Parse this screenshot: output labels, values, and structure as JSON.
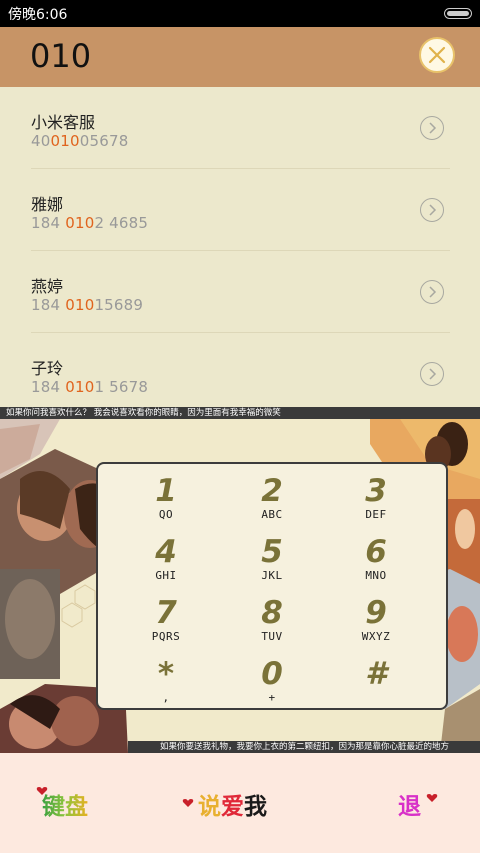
{
  "status_bar": {
    "time": "傍晚6:06"
  },
  "search": {
    "query": "010"
  },
  "results": [
    {
      "name": "小米客服",
      "number_prefix": "40",
      "number_match": "010",
      "number_suffix": "05678"
    },
    {
      "name": "雅娜",
      "number_prefix": "184 ",
      "number_match": "010",
      "number_suffix": "2 4685"
    },
    {
      "name": "燕婷",
      "number_prefix": "184 ",
      "number_match": "010",
      "number_suffix": "15689"
    },
    {
      "name": "子玲",
      "number_prefix": "184 ",
      "number_match": "010",
      "number_suffix": "1 5678"
    }
  ],
  "tickers": {
    "top": "如果你问我喜欢什么？ 我会说喜欢看你的眼睛，因为里面有我幸福的微笑",
    "bottom": "如果你要送我礼物，我要你上衣的第二颗纽扣，因为那是靠你心脏最近的地方"
  },
  "keypad": [
    {
      "digit": "1",
      "letters": "QO"
    },
    {
      "digit": "2",
      "letters": "ABC"
    },
    {
      "digit": "3",
      "letters": "DEF"
    },
    {
      "digit": "4",
      "letters": "GHI"
    },
    {
      "digit": "5",
      "letters": "JKL"
    },
    {
      "digit": "6",
      "letters": "MNO"
    },
    {
      "digit": "7",
      "letters": "PQRS"
    },
    {
      "digit": "8",
      "letters": "TUV"
    },
    {
      "digit": "9",
      "letters": "WXYZ"
    },
    {
      "digit": "*",
      "letters": ","
    },
    {
      "digit": "0",
      "letters": "+"
    },
    {
      "digit": "#",
      "letters": ""
    }
  ],
  "bottom_bar": {
    "keyboard": "键盘",
    "voice_chars": [
      "说",
      "爱",
      "我"
    ],
    "back": "退"
  },
  "colors": {
    "header": "#c79466",
    "highlight": "#e0641e",
    "keypad_digit": "#7a7238",
    "bottom_bg": "#fde9df"
  }
}
